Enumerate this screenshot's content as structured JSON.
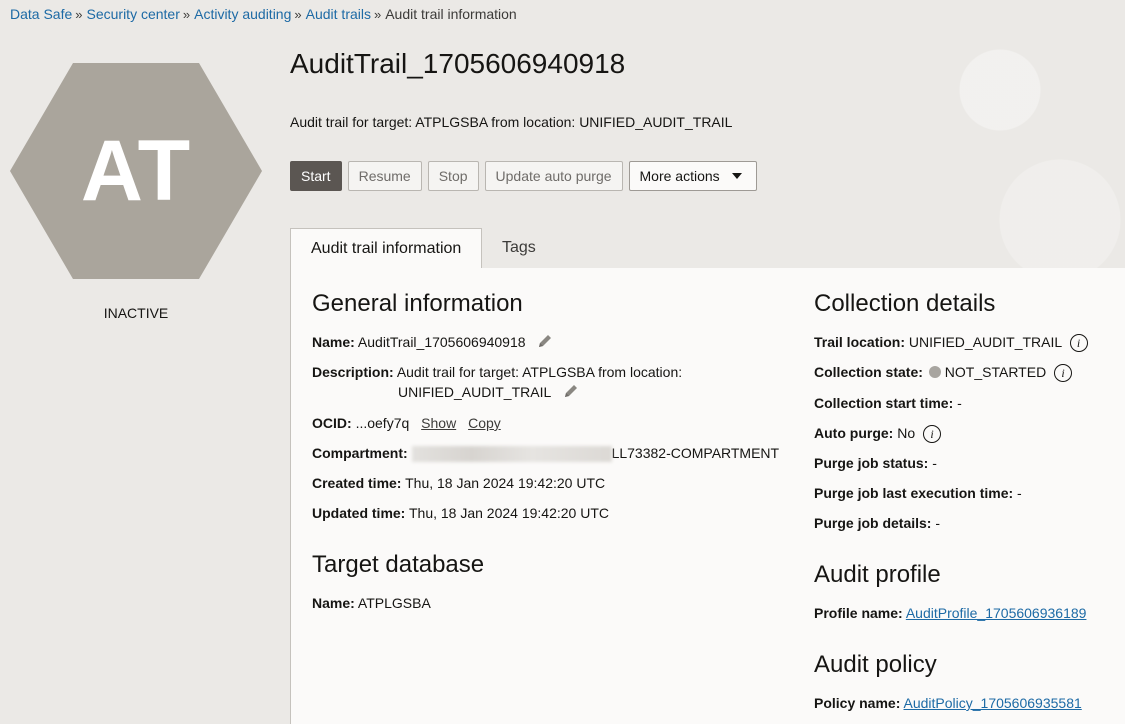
{
  "breadcrumb": {
    "items": [
      {
        "label": "Data Safe",
        "link": true
      },
      {
        "label": "Security center",
        "link": true
      },
      {
        "label": "Activity auditing",
        "link": true
      },
      {
        "label": "Audit trails",
        "link": true
      },
      {
        "label": "Audit trail information",
        "link": false
      }
    ],
    "separator": "»"
  },
  "badge": {
    "initials": "AT",
    "status": "INACTIVE",
    "color": "#aaa59c"
  },
  "header": {
    "title": "AuditTrail_1705606940918",
    "subtitle": "Audit trail for target: ATPLGSBA from location: UNIFIED_AUDIT_TRAIL"
  },
  "actions": {
    "start": "Start",
    "resume": "Resume",
    "stop": "Stop",
    "update_auto_purge": "Update auto purge",
    "more_actions": "More actions"
  },
  "tabs": {
    "info": "Audit trail information",
    "tags": "Tags"
  },
  "general": {
    "title": "General information",
    "name_label": "Name:",
    "name_value": "AuditTrail_1705606940918",
    "description_label": "Description:",
    "description_line1": "Audit trail for target: ATPLGSBA from location:",
    "description_line2": "UNIFIED_AUDIT_TRAIL",
    "ocid_label": "OCID:",
    "ocid_value": "...oefy7q",
    "ocid_show": "Show",
    "ocid_copy": "Copy",
    "compartment_label": "Compartment:",
    "compartment_value": "LL73382-COMPARTMENT",
    "created_label": "Created time:",
    "created_value": "Thu, 18 Jan 2024 19:42:20 UTC",
    "updated_label": "Updated time:",
    "updated_value": "Thu, 18 Jan 2024 19:42:20 UTC"
  },
  "target": {
    "title": "Target database",
    "name_label": "Name:",
    "name_value": "ATPLGSBA"
  },
  "collection": {
    "title": "Collection details",
    "trail_location_label": "Trail location:",
    "trail_location_value": "UNIFIED_AUDIT_TRAIL",
    "state_label": "Collection state:",
    "state_value": "NOT_STARTED",
    "start_time_label": "Collection start time:",
    "start_time_value": "-",
    "auto_purge_label": "Auto purge:",
    "auto_purge_value": "No",
    "purge_status_label": "Purge job status:",
    "purge_status_value": "-",
    "purge_last_label": "Purge job last execution time:",
    "purge_last_value": "-",
    "purge_details_label": "Purge job details:",
    "purge_details_value": "-"
  },
  "profile": {
    "title": "Audit profile",
    "name_label": "Profile name:",
    "name_value": "AuditProfile_1705606936189"
  },
  "policy": {
    "title": "Audit policy",
    "name_label": "Policy name:",
    "name_value": "AuditPolicy_1705606935581"
  },
  "icons": {
    "edit": "pencil-icon",
    "info": "info-icon",
    "dropdown": "caret-down-icon",
    "state": "status-dot-icon"
  },
  "colors": {
    "link": "#1d6aa5",
    "primary_button": "#5b5652",
    "state_dot": "#a8a5a0"
  }
}
